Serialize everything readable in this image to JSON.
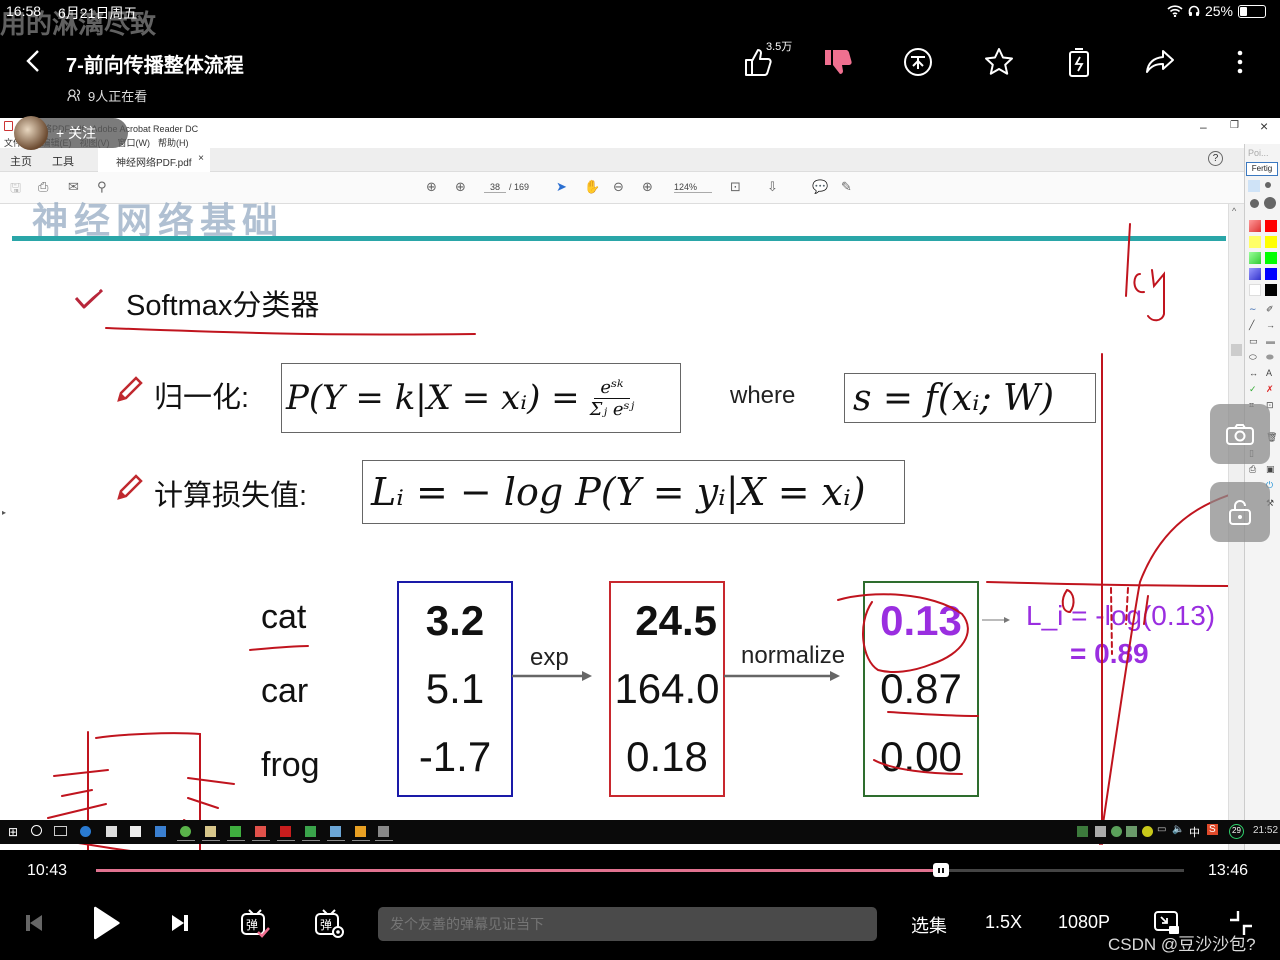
{
  "status_bar": {
    "time": "16:58",
    "date": "6月21日周五",
    "battery": "25%",
    "battery_level": 0.25
  },
  "danmaku_overlay": "用的淋漓尽致",
  "header": {
    "title": "7-前向传播整体流程",
    "viewers": "9人正在看",
    "like_count": "3.5万",
    "icons": [
      "thumbs-up-icon",
      "thumbs-down-icon",
      "coin-icon",
      "star-icon",
      "battery-charge-icon",
      "share-icon",
      "more-icon"
    ]
  },
  "follow": {
    "label": "+ 关注"
  },
  "acrobat": {
    "window_title": "神经网络PDF.pdf - Adobe Acrobat Reader DC",
    "menu": [
      "文件(F)",
      "编辑(E)",
      "视图(V)",
      "窗口(W)",
      "帮助(H)"
    ],
    "tabs": {
      "home": "主页",
      "tools": "工具",
      "doc": "神经网络PDF.pdf"
    },
    "page_current": "38",
    "page_total": "/ 169",
    "zoom": "124%",
    "palette_done": "Fertig",
    "palette_title": "Poi..."
  },
  "slide": {
    "header_partial": "神经网络基础",
    "title": "Softmax分类器",
    "normalize_label": "归一化:",
    "loss_label": "计算损失值:",
    "where": "where",
    "formula_prob_lhs": "P(Y = k|X = xᵢ) =",
    "formula_prob_num": "eˢᵏ",
    "formula_prob_den": "Σⱼ eˢʲ",
    "formula_score": "s = f(xᵢ; W)",
    "formula_loss": "Lᵢ = − log P(Y = yᵢ|X = xᵢ)",
    "classes": [
      "cat",
      "car",
      "frog"
    ],
    "scores": [
      "3.2",
      "5.1",
      "-1.7"
    ],
    "exp_values": [
      "24.5",
      "164.0",
      "0.18"
    ],
    "probs": [
      "0.13",
      "0.87",
      "0.00"
    ],
    "op_exp": "exp",
    "op_normalize": "normalize",
    "loss_line1": "L_i = -log(0.13)",
    "loss_line2": "= 0.89",
    "handwriting": "log",
    "handwriting_axis_0": "0.",
    "handwriting_axis_1": "1"
  },
  "taskbar": {
    "clock": "21:52",
    "ime": "中",
    "badge": "29"
  },
  "player": {
    "current_time": "10:43",
    "duration": "13:46",
    "progress": 0.777,
    "danmaku_placeholder": "发个友善的弹幕见证当下",
    "episodes": "选集",
    "speed": "1.5X",
    "quality": "1080P",
    "watermark": "CSDN @豆沙沙包?"
  }
}
